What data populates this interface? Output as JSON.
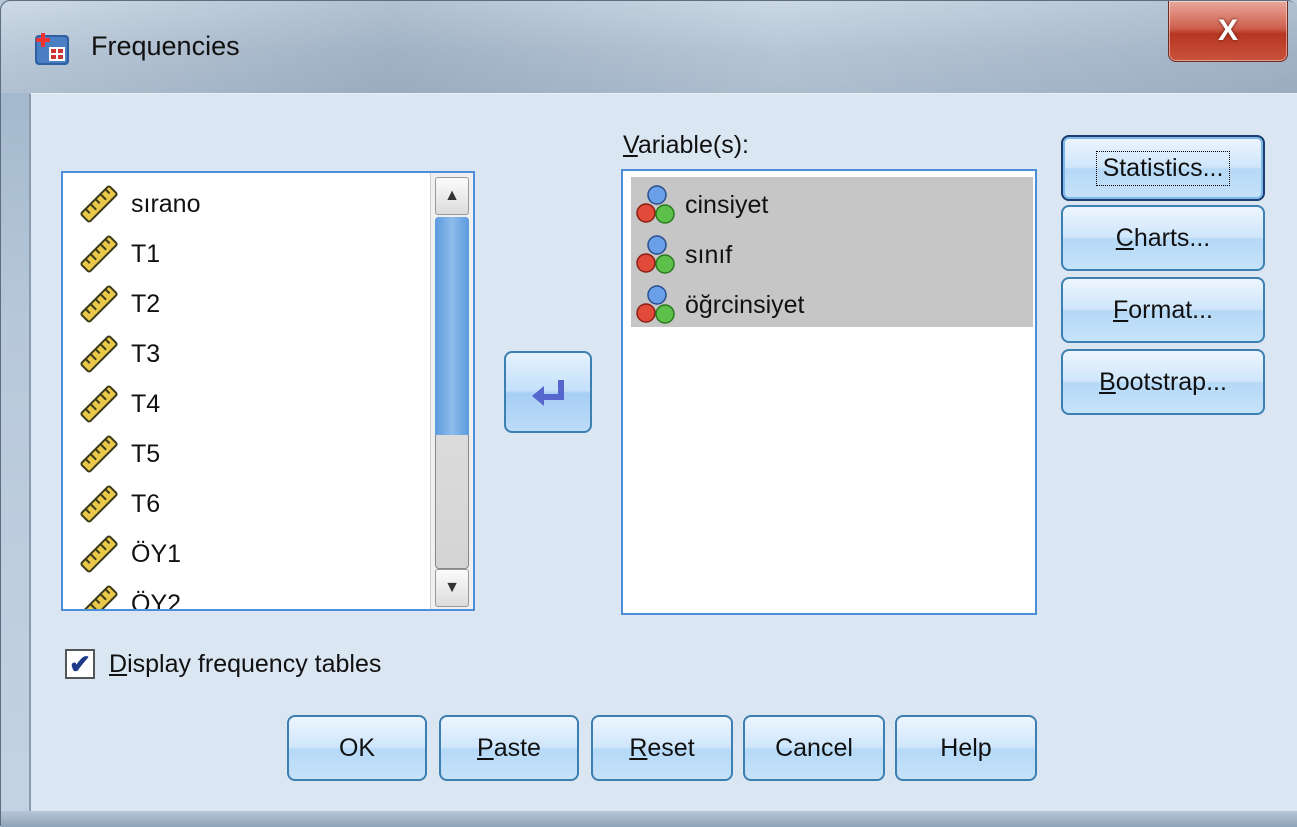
{
  "window": {
    "title": "Frequencies",
    "close_label": "X"
  },
  "source_list": {
    "items": [
      {
        "label": "sırano",
        "icon": "scale-ruler-icon"
      },
      {
        "label": "T1",
        "icon": "scale-ruler-icon"
      },
      {
        "label": "T2",
        "icon": "scale-ruler-icon"
      },
      {
        "label": "T3",
        "icon": "scale-ruler-icon"
      },
      {
        "label": "T4",
        "icon": "scale-ruler-icon"
      },
      {
        "label": "T5",
        "icon": "scale-ruler-icon"
      },
      {
        "label": "T6",
        "icon": "scale-ruler-icon"
      },
      {
        "label": "ÖY1",
        "icon": "scale-ruler-icon"
      },
      {
        "label": "ÖY2",
        "icon": "scale-ruler-icon"
      }
    ]
  },
  "target_list": {
    "label_first": "V",
    "label_rest": "ariable(s):",
    "items": [
      {
        "label": "cinsiyet",
        "icon": "nominal-variable-icon"
      },
      {
        "label": "sınıf",
        "icon": "nominal-variable-icon"
      },
      {
        "label": "öğrcinsiyet",
        "icon": "nominal-variable-icon"
      }
    ]
  },
  "side_buttons": {
    "statistics": "Statistics...",
    "charts_first": "C",
    "charts_rest": "harts...",
    "format_first": "F",
    "format_rest": "ormat...",
    "bootstrap_first": "B",
    "bootstrap_rest": "ootstrap..."
  },
  "checkbox": {
    "checked": true,
    "label_first": "D",
    "label_rest": "isplay frequency tables"
  },
  "bottom_buttons": {
    "ok": "OK",
    "paste_first": "P",
    "paste_rest": "aste",
    "reset_first": "R",
    "reset_rest": "eset",
    "cancel": "Cancel",
    "help": "Help"
  },
  "colors": {
    "accent_border": "#3c7fb1",
    "list_border": "#4a8fd8",
    "selection": "#c6c6c6",
    "close_red": "#c9533c"
  }
}
